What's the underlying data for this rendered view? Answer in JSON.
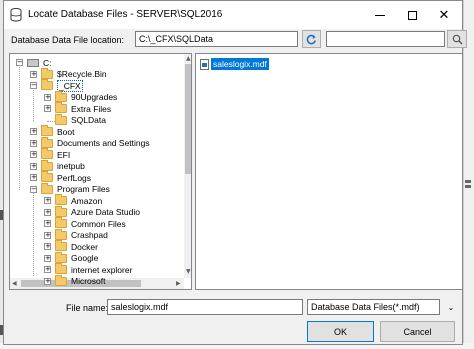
{
  "window": {
    "title": "Locate Database Files - SERVER\\SQL2016",
    "title_icon": "database-icon",
    "minimize": "minimize-icon",
    "maximize": "maximize-icon",
    "close_label": "✕"
  },
  "location": {
    "label": "Database Data File location:",
    "value": "C:\\_CFX\\SQLData",
    "refresh_icon": "refresh-icon",
    "search_value": "",
    "search_icon": "search-icon"
  },
  "tree": {
    "items": [
      {
        "label": "C:",
        "icon": "drive-icon",
        "expander": "−"
      },
      {
        "label": "$Recycle.Bin",
        "icon": "folder-icon",
        "expander": "+"
      },
      {
        "label": "_CFX",
        "icon": "folder-icon",
        "expander": "−"
      },
      {
        "label": "90Upgrades",
        "icon": "folder-icon",
        "expander": "+"
      },
      {
        "label": "Extra Files",
        "icon": "folder-icon",
        "expander": "+"
      },
      {
        "label": "SQLData",
        "icon": "folder-icon",
        "expander": ""
      },
      {
        "label": "Boot",
        "icon": "folder-icon",
        "expander": "+"
      },
      {
        "label": "Documents and Settings",
        "icon": "folder-icon",
        "expander": "+"
      },
      {
        "label": "EFI",
        "icon": "folder-icon",
        "expander": "+"
      },
      {
        "label": "inetpub",
        "icon": "folder-icon",
        "expander": "+"
      },
      {
        "label": "PerfLogs",
        "icon": "folder-icon",
        "expander": "+"
      },
      {
        "label": "Program Files",
        "icon": "folder-icon",
        "expander": "−"
      },
      {
        "label": "Amazon",
        "icon": "folder-icon",
        "expander": "+"
      },
      {
        "label": "Azure Data Studio",
        "icon": "folder-icon",
        "expander": "+"
      },
      {
        "label": "Common Files",
        "icon": "folder-icon",
        "expander": "+"
      },
      {
        "label": "Crashpad",
        "icon": "folder-icon",
        "expander": "+"
      },
      {
        "label": "Docker",
        "icon": "folder-icon",
        "expander": "+"
      },
      {
        "label": "Google",
        "icon": "folder-icon",
        "expander": "+"
      },
      {
        "label": "internet explorer",
        "icon": "folder-icon",
        "expander": "+"
      },
      {
        "label": "Microsoft",
        "icon": "folder-icon",
        "expander": "+"
      }
    ],
    "selected": "_CFX"
  },
  "files": {
    "items": [
      {
        "label": "saleslogix.mdf",
        "icon": "file-icon"
      }
    ]
  },
  "file_name": {
    "label": "File name:",
    "value": "saleslogix.mdf"
  },
  "file_type": {
    "value": "Database Data Files(*.mdf)"
  },
  "buttons": {
    "ok": "OK",
    "cancel": "Cancel"
  },
  "colors": {
    "selection": "#0078d7",
    "folder": "#f4c96a",
    "dialog_bg": "#f0f0f0"
  }
}
